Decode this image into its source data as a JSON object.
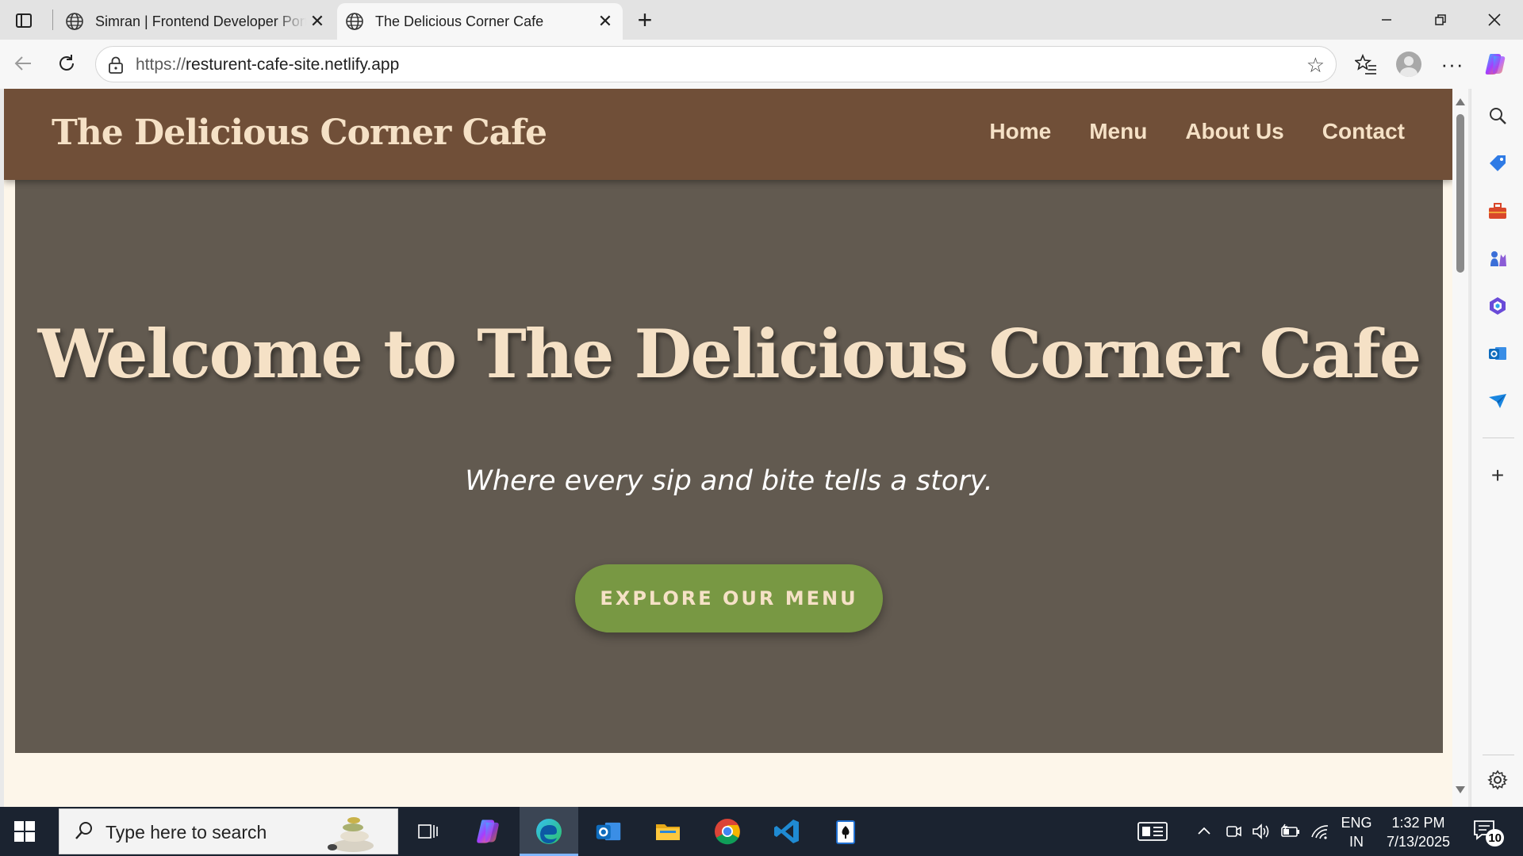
{
  "browser": {
    "tabs": [
      {
        "title": "Simran | Frontend Developer Portfolio",
        "active": false
      },
      {
        "title": "The Delicious Corner Cafe",
        "active": true
      }
    ],
    "address": {
      "scheme": "https://",
      "host": "resturent-cafe-site.netlify.app"
    }
  },
  "site": {
    "logo": "The Delicious Corner Cafe",
    "nav": [
      "Home",
      "Menu",
      "About Us",
      "Contact"
    ],
    "hero": {
      "heading": "Welcome to The Delicious Corner Cafe",
      "tagline": "Where every sip and bite tells a story.",
      "cta": "EXPLORE OUR MENU"
    },
    "colors": {
      "header_bg": "#704f38",
      "hero_bg": "#625a50",
      "accent_text": "#f5e1c6",
      "cta_bg": "#789843",
      "page_bg": "#fdf6ea"
    }
  },
  "taskbar": {
    "search_placeholder": "Type here to search",
    "language": [
      "ENG",
      "IN"
    ],
    "time": "1:32 PM",
    "date": "7/13/2025",
    "notification_count": "10"
  }
}
